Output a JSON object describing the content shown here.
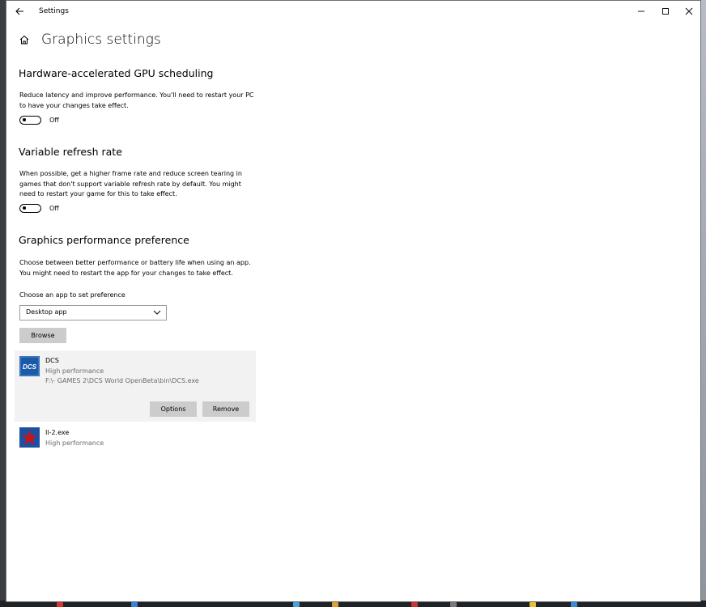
{
  "window": {
    "app_title": "Settings"
  },
  "page": {
    "title": "Graphics settings"
  },
  "gpu_scheduling": {
    "heading": "Hardware-accelerated GPU scheduling",
    "description": "Reduce latency and improve performance. You'll need to restart your PC to have your changes take effect.",
    "toggle_label": "Off"
  },
  "variable_refresh": {
    "heading": "Variable refresh rate",
    "description": "When possible, get a higher frame rate and reduce screen tearing in games that don't support variable refresh rate by default. You might need to restart your game for this to take effect.",
    "toggle_label": "Off"
  },
  "performance_pref": {
    "heading": "Graphics performance preference",
    "description": "Choose between better performance or battery life when using an app. You might need to restart the app for your changes to take effect.",
    "choose_label": "Choose an app to set preference",
    "dropdown_value": "Desktop app",
    "browse_label": "Browse"
  },
  "apps": [
    {
      "name": "DCS",
      "preference": "High performance",
      "path": "F:\\- GAMES 2\\DCS World OpenBeta\\bin\\DCS.exe",
      "icon": "dcs-app-icon",
      "icon_text": "DCS",
      "options_label": "Options",
      "remove_label": "Remove"
    },
    {
      "name": "Il-2.exe",
      "preference": "High performance",
      "icon": "il2-star-icon"
    }
  ],
  "colors": {
    "selected_bg": "#f2f2f2",
    "button_bg": "#cccccc",
    "dcs_blue": "#1c5aa8",
    "il2_blue": "#1e4fa0",
    "il2_star": "#c0161c"
  }
}
